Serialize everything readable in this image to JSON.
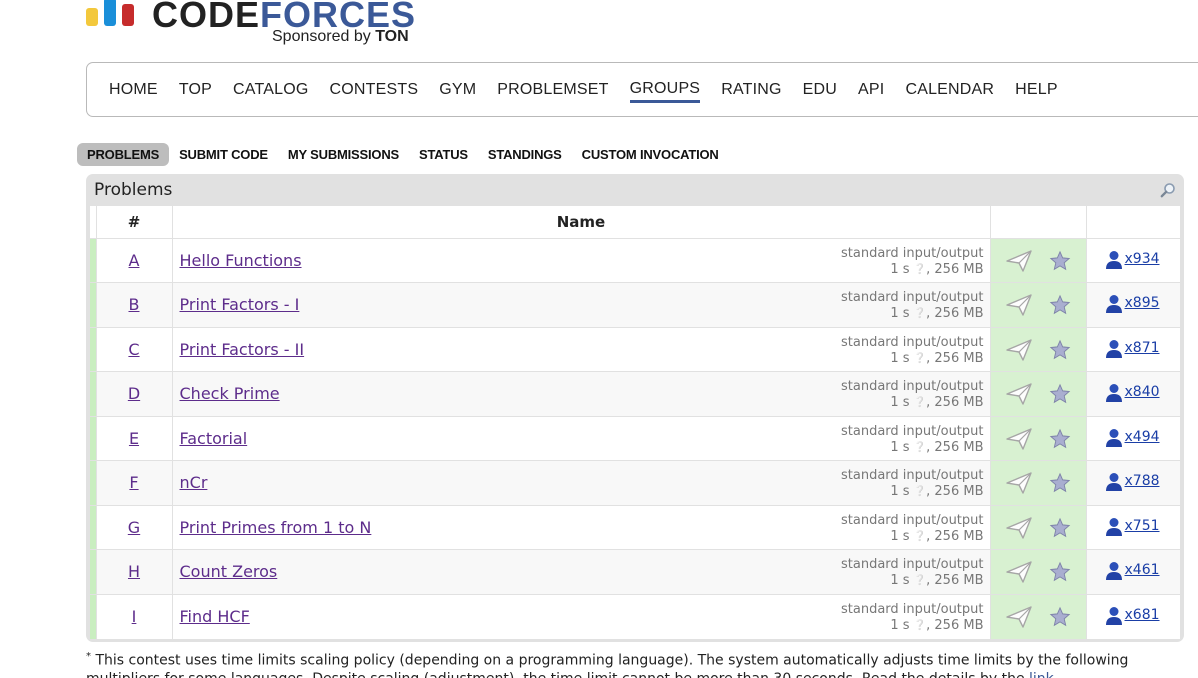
{
  "logo": {
    "word_code": "CODE",
    "word_forces": "FORCES",
    "sponsor_prefix": "Sponsored by",
    "sponsor_name": "TON",
    "colors": {
      "bar1": "#f3c83c",
      "bar2": "#1a8fd9",
      "bar3": "#c62c2c",
      "forces": "#3b5998"
    }
  },
  "main_menu": {
    "items": [
      "HOME",
      "TOP",
      "CATALOG",
      "CONTESTS",
      "GYM",
      "PROBLEMSET",
      "GROUPS",
      "RATING",
      "EDU",
      "API",
      "CALENDAR",
      "HELP"
    ],
    "active": "GROUPS"
  },
  "second_menu": {
    "tabs": [
      "PROBLEMS",
      "SUBMIT CODE",
      "MY SUBMISSIONS",
      "STATUS",
      "STANDINGS",
      "CUSTOM INVOCATION"
    ],
    "selected": "PROBLEMS"
  },
  "problems_box": {
    "title": "Problems",
    "search_icon": "magnifier-icon",
    "headers": {
      "index": "#",
      "name": "Name"
    },
    "rows": [
      {
        "index": "A",
        "name": "Hello Functions",
        "io": "standard input/output",
        "time": "1 s",
        "memory": ", 256 MB",
        "solved": "x934"
      },
      {
        "index": "B",
        "name": "Print Factors - I",
        "io": "standard input/output",
        "time": "1 s",
        "memory": ", 256 MB",
        "solved": "x895"
      },
      {
        "index": "C",
        "name": "Print Factors - II",
        "io": "standard input/output",
        "time": "1 s",
        "memory": ", 256 MB",
        "solved": "x871"
      },
      {
        "index": "D",
        "name": "Check Prime",
        "io": "standard input/output",
        "time": "1 s",
        "memory": ", 256 MB",
        "solved": "x840"
      },
      {
        "index": "E",
        "name": "Factorial",
        "io": "standard input/output",
        "time": "1 s",
        "memory": ", 256 MB",
        "solved": "x494"
      },
      {
        "index": "F",
        "name": "nCr",
        "io": "standard input/output",
        "time": "1 s",
        "memory": ", 256 MB",
        "solved": "x788"
      },
      {
        "index": "G",
        "name": "Print Primes from 1 to N",
        "io": "standard input/output",
        "time": "1 s",
        "memory": ", 256 MB",
        "solved": "x751"
      },
      {
        "index": "H",
        "name": "Count Zeros",
        "io": "standard input/output",
        "time": "1 s",
        "memory": ", 256 MB",
        "solved": "x461"
      },
      {
        "index": "I",
        "name": "Find HCF",
        "io": "standard input/output",
        "time": "1 s",
        "memory": ", 256 MB",
        "solved": "x681"
      }
    ]
  },
  "footnote": {
    "asterisk": "*",
    "text": " This contest uses time limits scaling policy (depending on a programming language). The system automatically adjusts time limits by the following multipliers for some languages. Despite scaling (adjustment), the time limit cannot be more than 30 seconds. Read the details by the ",
    "link": "link"
  }
}
